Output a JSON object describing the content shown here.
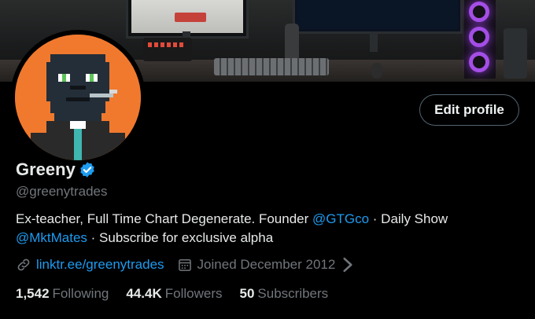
{
  "profile": {
    "name": "Greeny",
    "handle": "@greenytrades",
    "verified_icon": "verified-badge-icon",
    "edit_button_label": "Edit profile"
  },
  "bio": {
    "part1": "Ex-teacher, Full Time Chart Degenerate. Founder ",
    "mention1": "@GTGco",
    "part2": " · Daily Show",
    "mention2": "@MktMates",
    "part3": " · Subscribe for exclusive alpha"
  },
  "meta": {
    "link_icon": "link-icon",
    "link_text": "linktr.ee/greenytrades",
    "calendar_icon": "calendar-icon",
    "joined_text": "Joined December 2012",
    "chevron_icon": "chevron-right-icon"
  },
  "stats": {
    "following_count": "1,542",
    "following_label": "Following",
    "followers_count": "44.4K",
    "followers_label": "Followers",
    "subscribers_count": "50",
    "subscribers_label": "Subscribers"
  },
  "colors": {
    "accent": "#1d9bf0",
    "avatar_bg": "#f0792e",
    "secondary_text": "#71767b"
  }
}
